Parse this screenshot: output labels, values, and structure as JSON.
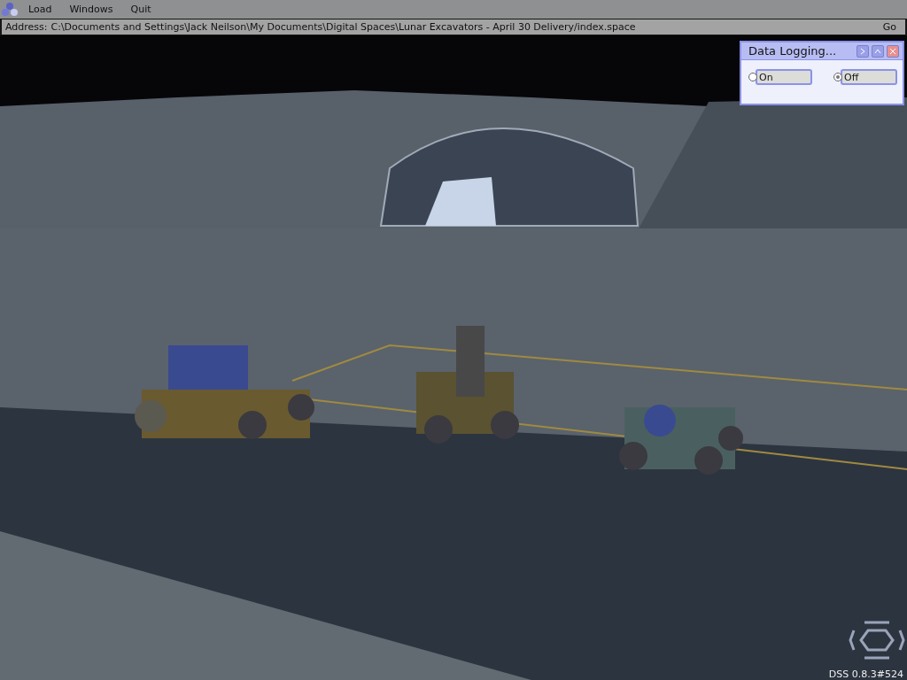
{
  "menu": [
    {
      "label": "Load"
    },
    {
      "label": "Windows"
    },
    {
      "label": "Quit"
    }
  ],
  "address_bar": {
    "label": "Address:",
    "value": "C:\\Documents and Settings\\Jack Neilson\\My Documents\\Digital Spaces\\Lunar Excavators - April 30 Delivery/index.space",
    "button": "Go"
  },
  "data_logging_panel": {
    "title": "Data Logging...",
    "options": [
      {
        "label": "On",
        "selected": false
      },
      {
        "label": "Off",
        "selected": true
      }
    ]
  },
  "version": "DSS 0.8.3#524"
}
